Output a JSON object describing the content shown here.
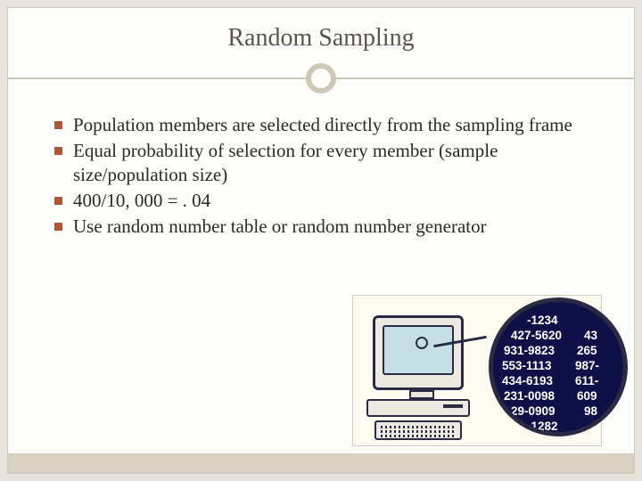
{
  "title": "Random Sampling",
  "bullets": [
    "Population members are selected directly from the sampling frame",
    "Equal probability of selection for every member (sample size/population size)",
    "400/10, 000 = . 04",
    "Use random number table or random number generator"
  ],
  "magnifier": {
    "rows": [
      {
        "left": "-1234",
        "right": ""
      },
      {
        "left": "427-5620",
        "right": "43"
      },
      {
        "left": "931-9823",
        "right": "265"
      },
      {
        "left": "553-1113",
        "right": "987-"
      },
      {
        "left": "434-6193",
        "right": "611-"
      },
      {
        "left": "231-0098",
        "right": "609"
      },
      {
        "left": "29-0909",
        "right": "98"
      },
      {
        "left": "-1282",
        "right": ""
      }
    ]
  }
}
